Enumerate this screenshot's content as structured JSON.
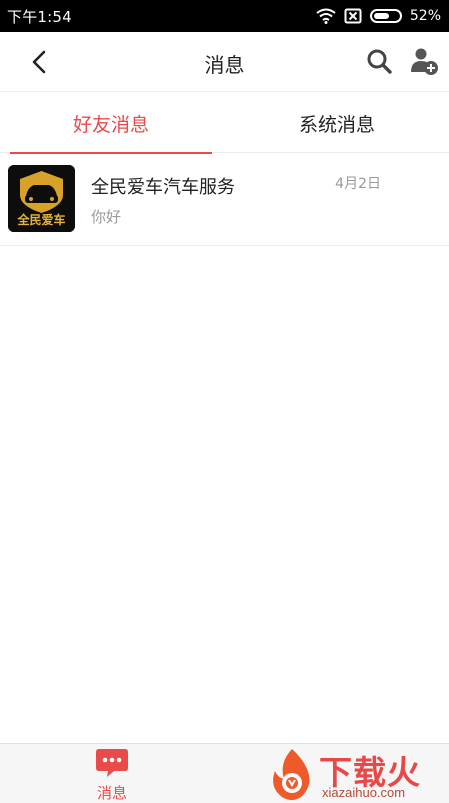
{
  "status_bar": {
    "time": "下午1:54",
    "battery_percent": "52%",
    "icons": [
      "wifi-icon",
      "no-sim-icon",
      "battery-icon"
    ]
  },
  "header": {
    "title": "消息",
    "icons": [
      "back-chevron-icon",
      "search-icon",
      "add-friend-icon"
    ]
  },
  "tabs": [
    {
      "label": "好友消息",
      "active": true
    },
    {
      "label": "系统消息",
      "active": false
    }
  ],
  "messages": [
    {
      "sender": "全民爱车汽车服务",
      "date": "4月2日",
      "preview": "你好",
      "avatar_text": "全民爱车"
    }
  ],
  "bottom_nav": {
    "items": [
      {
        "label": "消息",
        "icon": "chat-bubble-icon",
        "active": true
      }
    ]
  },
  "watermark": {
    "text": "下载火",
    "subtext": "xiazaihuo.com"
  },
  "colors": {
    "accent": "#e94a4a",
    "status_bar_bg": "#000000",
    "secondary_text": "#999999"
  }
}
